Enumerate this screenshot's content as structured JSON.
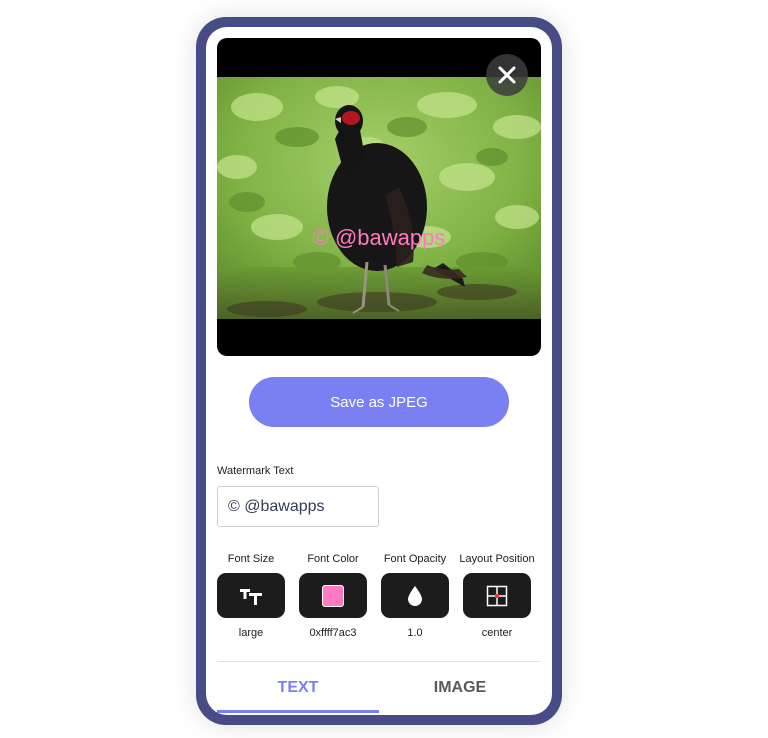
{
  "preview": {
    "watermark_text": "© @bawapps"
  },
  "actions": {
    "save_label": "Save as JPEG"
  },
  "watermark_field": {
    "label": "Watermark Text",
    "value": "© @bawapps"
  },
  "controls": [
    {
      "label": "Font Size",
      "value": "large",
      "icon": "text-size-icon"
    },
    {
      "label": "Font Color",
      "value": "0xffff7ac3",
      "icon": "color-swatch-icon",
      "swatch_color": "#ff7ac3"
    },
    {
      "label": "Font Opacity",
      "value": "1.0",
      "icon": "droplet-icon"
    },
    {
      "label": "Layout Position",
      "value": "center",
      "icon": "grid-position-icon"
    }
  ],
  "tabs": [
    {
      "label": "TEXT",
      "active": true
    },
    {
      "label": "IMAGE",
      "active": false
    }
  ],
  "colors": {
    "frame": "#474b86",
    "accent": "#7a80f2",
    "watermark": "#ff7ac3",
    "control_bg": "#1c1c1c"
  }
}
